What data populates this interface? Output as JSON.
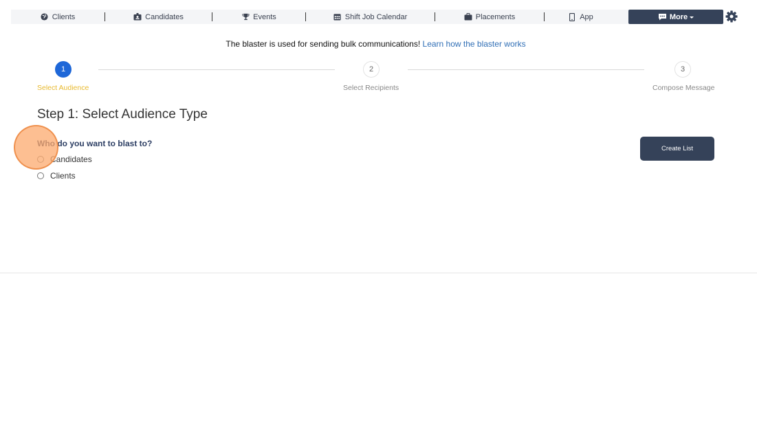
{
  "nav": {
    "items": [
      {
        "label": "Clients",
        "icon": "globe-icon"
      },
      {
        "label": "Candidates",
        "icon": "id-badge-icon"
      },
      {
        "label": "Events",
        "icon": "trophy-icon"
      },
      {
        "label": "Shift Job Calendar",
        "icon": "calendar-icon"
      },
      {
        "label": "Placements",
        "icon": "briefcase-icon"
      },
      {
        "label": "App",
        "icon": "mobile-icon"
      }
    ],
    "more_label": "More",
    "more_icon": "chat-icon",
    "settings_icon": "gear-icon"
  },
  "info": {
    "text": "The blaster is used for sending bulk communications! ",
    "link_text": "Learn how the blaster works"
  },
  "stepper": {
    "steps": [
      {
        "number": "1",
        "label": "Select Audience"
      },
      {
        "number": "2",
        "label": "Select Recipients"
      },
      {
        "number": "3",
        "label": "Compose Message"
      }
    ],
    "active_color": "#1e67d8",
    "active_label_color": "#e8b92e"
  },
  "main": {
    "title": "Step 1: Select Audience Type",
    "question": "Who do you want to blast to?",
    "options": [
      "Candidates",
      "Clients"
    ],
    "create_list_label": "Create List"
  },
  "colors": {
    "primary_dark": "#354259",
    "link": "#2f6eb5",
    "click_marker": "#fcaa6e"
  }
}
